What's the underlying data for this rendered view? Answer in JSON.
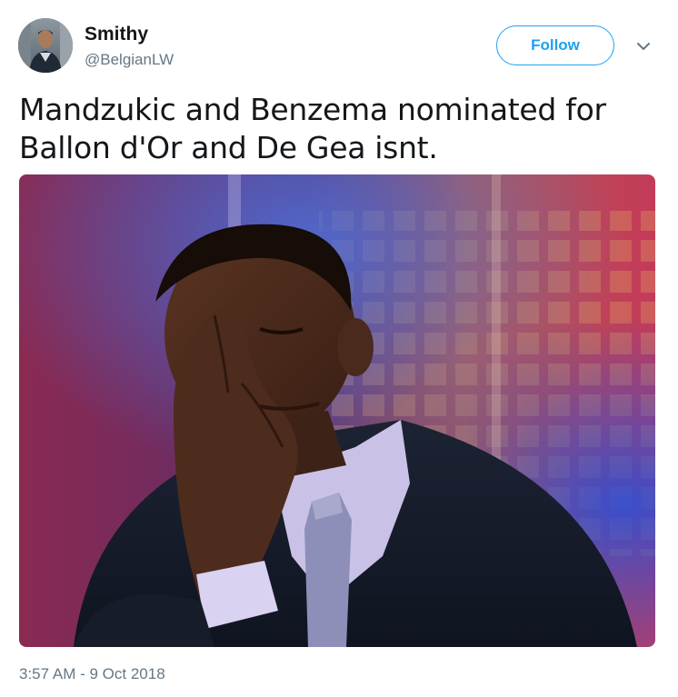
{
  "author": {
    "display_name": "Smithy",
    "handle": "@BelgianLW"
  },
  "actions": {
    "follow_label": "Follow",
    "menu_icon": "chevron-down-icon"
  },
  "tweet": {
    "text": "Mandzukic and Benzema nominated for Ballon d'Or and De Gea isnt.",
    "timestamp": "3:57 AM - 9 Oct 2018"
  },
  "colors": {
    "accent": "#1da1f2",
    "secondary_text": "#657786",
    "primary_text": "#14171a"
  }
}
